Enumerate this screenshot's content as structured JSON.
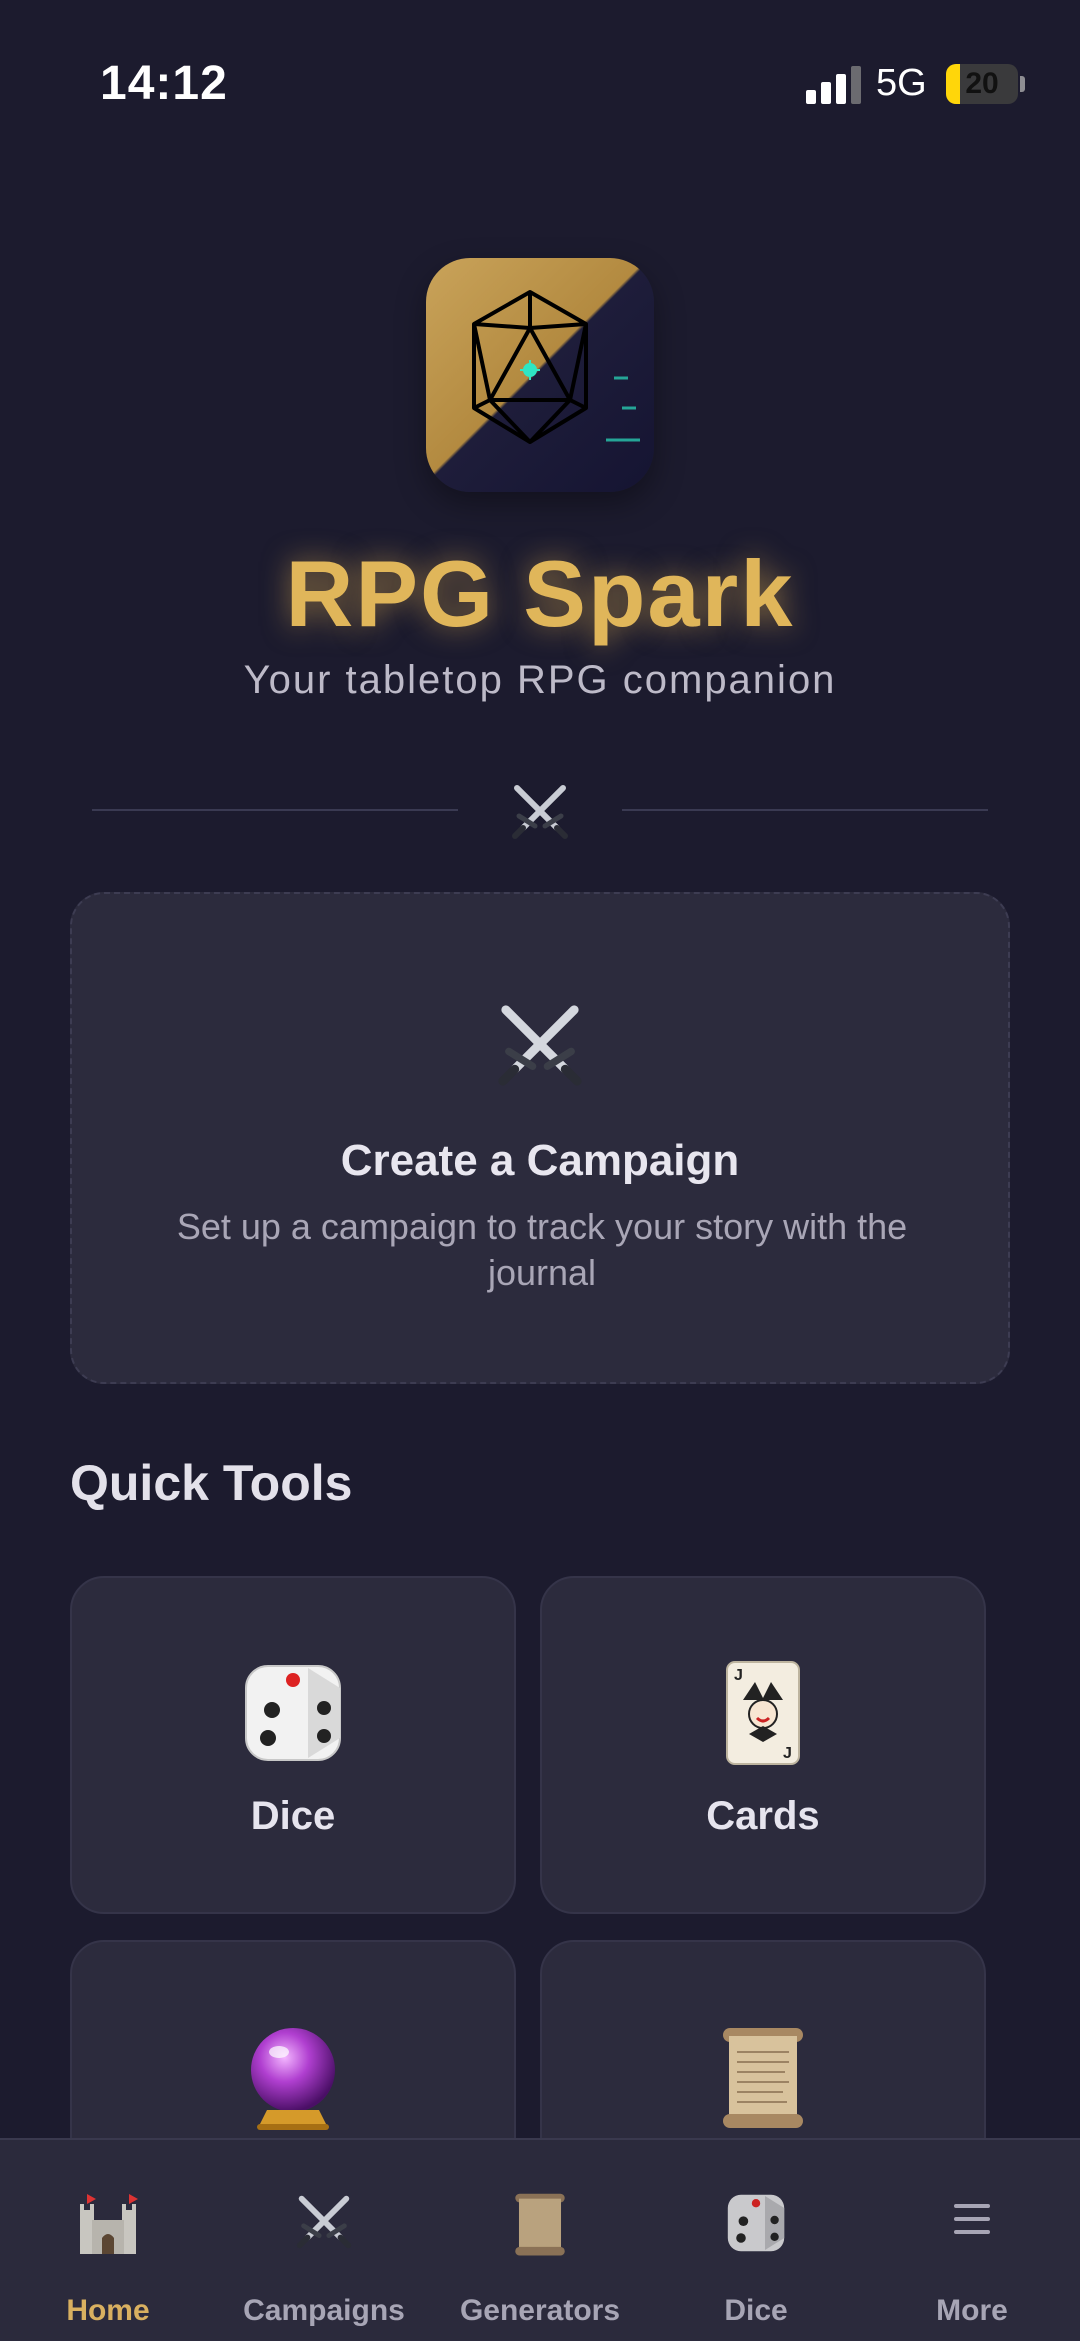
{
  "status_bar": {
    "time": "14:12",
    "network": "5G",
    "battery": "20",
    "battery_fraction": 0.2
  },
  "hero": {
    "title": "RPG Spark",
    "tagline": "Your tabletop RPG companion",
    "logo_icon": "d20-icon",
    "divider_icon": "crossed-swords-icon"
  },
  "campaign_card": {
    "icon": "crossed-swords-icon",
    "title": "Create a Campaign",
    "description": "Set up a campaign to track your story with the journal"
  },
  "quick_tools": {
    "title": "Quick Tools",
    "items": [
      {
        "label": "Dice",
        "icon": "dice-icon"
      },
      {
        "label": "Cards",
        "icon": "joker-card-icon"
      },
      {
        "label": "",
        "icon": "crystal-ball-icon"
      },
      {
        "label": "",
        "icon": "scroll-icon"
      }
    ]
  },
  "tab_bar": {
    "active": "Home",
    "accent": "#d9b060",
    "items": [
      {
        "label": "Home",
        "icon": "castle-icon"
      },
      {
        "label": "Campaigns",
        "icon": "crossed-swords-icon"
      },
      {
        "label": "Generators",
        "icon": "scroll-icon"
      },
      {
        "label": "Dice",
        "icon": "dice-icon"
      },
      {
        "label": "More",
        "icon": "hamburger-menu-icon"
      }
    ]
  }
}
